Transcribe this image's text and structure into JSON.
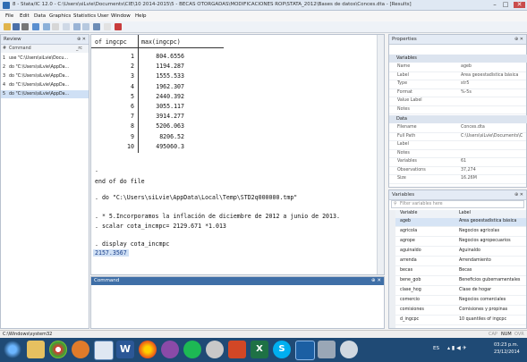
{
  "window": {
    "title": "8 - Stata/IC 12.0 - C:\\Users\\siLvie\\Documents\\CIE\\10 2014-2015\\5 - BECAS OTORGADAS\\MODIFICACIONES ROP\\STATA_2012\\Bases de datos\\Conces.dta - [Results]",
    "controls": [
      "–",
      "□",
      "✕"
    ]
  },
  "menu": [
    "File",
    "Edit",
    "Data",
    "Graphics",
    "Statistics",
    "User",
    "Window",
    "Help"
  ],
  "review": {
    "title": "Review",
    "col_num": "#",
    "col_cmd": "Command",
    "col_rc": "_rc",
    "items": [
      {
        "n": "1",
        "cmd": "use \"C:\\Users\\siLvie\\Docu..."
      },
      {
        "n": "2",
        "cmd": "do \"C:\\Users\\siLvie\\AppDa..."
      },
      {
        "n": "3",
        "cmd": "do \"C:\\Users\\siLvie\\AppDa..."
      },
      {
        "n": "4",
        "cmd": "do \"C:\\Users\\siLvie\\AppDa..."
      },
      {
        "n": "5",
        "cmd": "do \"C:\\Users\\siLvie\\AppDa..."
      }
    ]
  },
  "results": {
    "header_left": "of ingcpc",
    "header_right": "max(ingcpc)",
    "rows": [
      {
        "i": "1",
        "v": "804.6556"
      },
      {
        "i": "2",
        "v": "1194.287"
      },
      {
        "i": "3",
        "v": "1555.533"
      },
      {
        "i": "4",
        "v": "1962.307"
      },
      {
        "i": "5",
        "v": "2440.392"
      },
      {
        "i": "6",
        "v": "3055.117"
      },
      {
        "i": "7",
        "v": "3914.277"
      },
      {
        "i": "8",
        "v": "5206.063"
      },
      {
        "i": "9",
        "v": "8206.52"
      },
      {
        "i": "10",
        "v": "495060.3"
      }
    ],
    "dot": ".",
    "end_line": "end of do file",
    "do_line": ". do \"C:\\Users\\siLvie\\AppData\\Local\\Temp\\STD2q000000.tmp\"",
    "comment_line": ". * 5.Incorporamos la inflación de diciembre de 2012 a junio de 2013.",
    "scalar_line": ". scalar cota_incmpc= 2129.671 *1.013",
    "display_line": ". display cota_incmpc",
    "display_value": "2157.3567"
  },
  "command": {
    "title": "Command"
  },
  "properties": {
    "title": "Properties",
    "variables_section": "Variables",
    "var_rows": [
      {
        "k": "Name",
        "v": "ageb"
      },
      {
        "k": "Label",
        "v": "Área geoestadística básica"
      },
      {
        "k": "Type",
        "v": "str5"
      },
      {
        "k": "Format",
        "v": "%-5s"
      },
      {
        "k": "Value Label",
        "v": ""
      },
      {
        "k": "Notes",
        "v": ""
      }
    ],
    "data_section": "Data",
    "data_rows": [
      {
        "k": "Filename",
        "v": "Conces.dta"
      },
      {
        "k": "Full Path",
        "v": "C:\\Users\\siLvie\\Documents\\C"
      },
      {
        "k": "Label",
        "v": ""
      },
      {
        "k": "Notes",
        "v": ""
      },
      {
        "k": "Variables",
        "v": "61"
      },
      {
        "k": "Observations",
        "v": "37,274"
      },
      {
        "k": "Size",
        "v": "16.26M"
      }
    ]
  },
  "variables": {
    "title": "Variables",
    "filter_placeholder": "Filter variables here",
    "col_var": "Variable",
    "col_label": "Label",
    "rows": [
      {
        "n": "ageb",
        "l": "Área geoestadística básica"
      },
      {
        "n": "agricola",
        "l": "Negocios agrícolas"
      },
      {
        "n": "agrope",
        "l": "Negocios agropecuarios"
      },
      {
        "n": "aguinaldo",
        "l": "Aguinaldo"
      },
      {
        "n": "arrenda",
        "l": "Arrendamiento"
      },
      {
        "n": "becas",
        "l": "Becas"
      },
      {
        "n": "bene_gob",
        "l": "Beneficios gubernamentales"
      },
      {
        "n": "clase_hog",
        "l": "Clase de hogar"
      },
      {
        "n": "comercio",
        "l": "Negocios comerciales"
      },
      {
        "n": "comisiones",
        "l": "Comisiones y propinas"
      },
      {
        "n": "d_ingcpc",
        "l": "10 quantiles of ingcpc"
      }
    ]
  },
  "status": {
    "path": "C:\\Windows\\system32",
    "indicators": [
      "CAP",
      "NUM",
      "OVR"
    ]
  },
  "taskbar": {
    "lang": "ES",
    "time": "03:23 p.m.",
    "date": "23/12/2014",
    "apps": [
      "start",
      "explorer",
      "chrome",
      "firefox-like",
      "word",
      "firefox",
      "media",
      "spotify",
      "itunes",
      "powerpoint",
      "excel",
      "skype",
      "stata",
      "calc",
      "another"
    ]
  }
}
